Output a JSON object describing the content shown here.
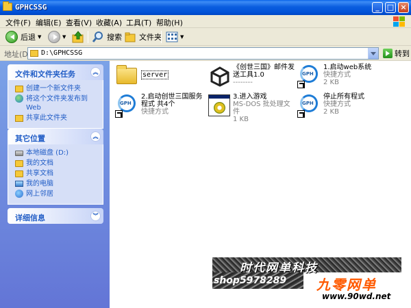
{
  "window": {
    "title": "GPHCSSG"
  },
  "menu": [
    "文件(F)",
    "编辑(E)",
    "查看(V)",
    "收藏(A)",
    "工具(T)",
    "帮助(H)"
  ],
  "toolbar": {
    "back": "后退",
    "search": "搜索",
    "folders": "文件夹"
  },
  "address": {
    "label": "地址(D)",
    "value": "D:\\GPHCSSG",
    "go": "转到"
  },
  "tasks": {
    "title": "文件和文件夹任务",
    "items": [
      "创建一个新文件夹",
      "将这个文件夹发布到 Web",
      "共享此文件夹"
    ]
  },
  "places": {
    "title": "其它位置",
    "items": [
      "本地磁盘 (D:)",
      "我的文档",
      "共享文档",
      "我的电脑",
      "网上邻居"
    ]
  },
  "details": {
    "title": "详细信息"
  },
  "files": [
    {
      "name": "server",
      "sub": "",
      "size": ""
    },
    {
      "name": "《创世三国》邮件发送工具1.0",
      "sub": "--------",
      "size": ""
    },
    {
      "name": "1.启动web系统",
      "sub": "快捷方式",
      "size": "2 KB"
    },
    {
      "name": "2.启动创世三国服务程式 共4个",
      "sub": "快捷方式",
      "size": ""
    },
    {
      "name": "3.进入游戏",
      "sub": "MS-DOS 批处理文件",
      "size": "1 KB"
    },
    {
      "name": "停止所有程式",
      "sub": "快捷方式",
      "size": "2 KB"
    }
  ],
  "watermark": {
    "line1": "时代网单科技",
    "line2": "shop5978289",
    "brand": "九零网单",
    "url": "www.90wd.net"
  },
  "colors": {
    "title_bar": "#0153d8",
    "link_blue": "#215dc6",
    "brand_orange": "#ff5a00"
  }
}
